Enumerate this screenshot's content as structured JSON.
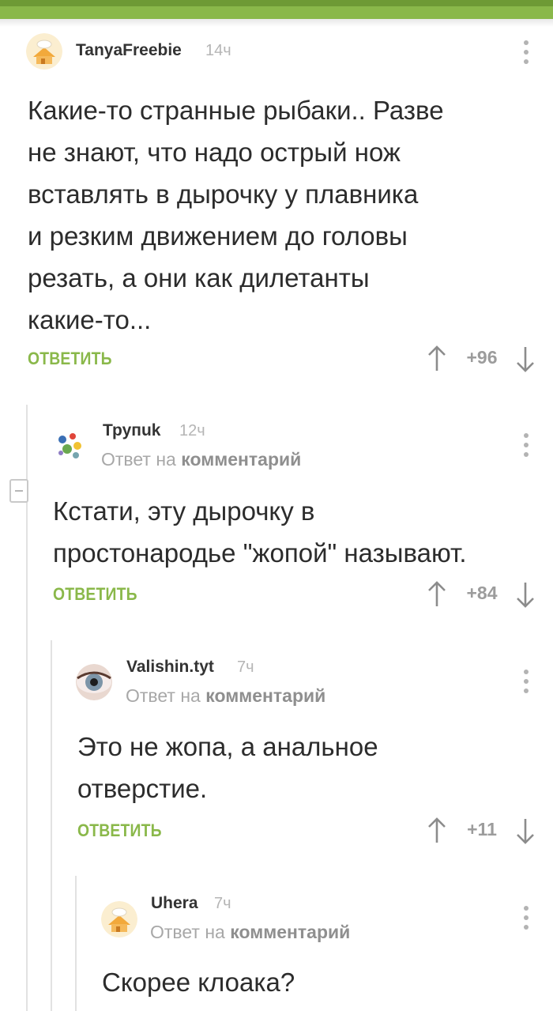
{
  "comments": [
    {
      "author": "TanyaFreebie",
      "time": "14ч",
      "text_lines": [
        "Какие-то странные рыбаки.. Разве",
        "не знают, что надо острый нож",
        "вставлять в дырочку у плавника",
        "и резким движением до головы",
        "резать, а они как дилетанты",
        "какие-то..."
      ],
      "reply_label": "ОТВЕТИТЬ",
      "score": "+96"
    },
    {
      "author": "Трупuk",
      "time": "12ч",
      "reply_to_prefix": "Ответ на",
      "reply_to_target": "комментарий",
      "text_lines": [
        "Кстати, эту дырочку в",
        "простонародье \"жопой\" называют."
      ],
      "reply_label": "ОТВЕТИТЬ",
      "score": "+84"
    },
    {
      "author": "Valishin.tyt",
      "time": "7ч",
      "reply_to_prefix": "Ответ на",
      "reply_to_target": "комментарий",
      "text_lines": [
        "Это не жопа, а анальное",
        "отверстие."
      ],
      "reply_label": "ОТВЕТИТЬ",
      "score": "+11"
    },
    {
      "author": "Uhera",
      "time": "7ч",
      "reply_to_prefix": "Ответ на",
      "reply_to_target": "комментарий",
      "text_lines": [
        "Скорее клоака?"
      ]
    }
  ],
  "icons": {
    "vote_up": "arrow-up-icon",
    "vote_down": "arrow-down-icon",
    "menu": "kebab-menu-icon",
    "collapse": "collapse-minus-icon"
  },
  "colors": {
    "accent": "#8ab84a",
    "header": "#6e9a35"
  }
}
